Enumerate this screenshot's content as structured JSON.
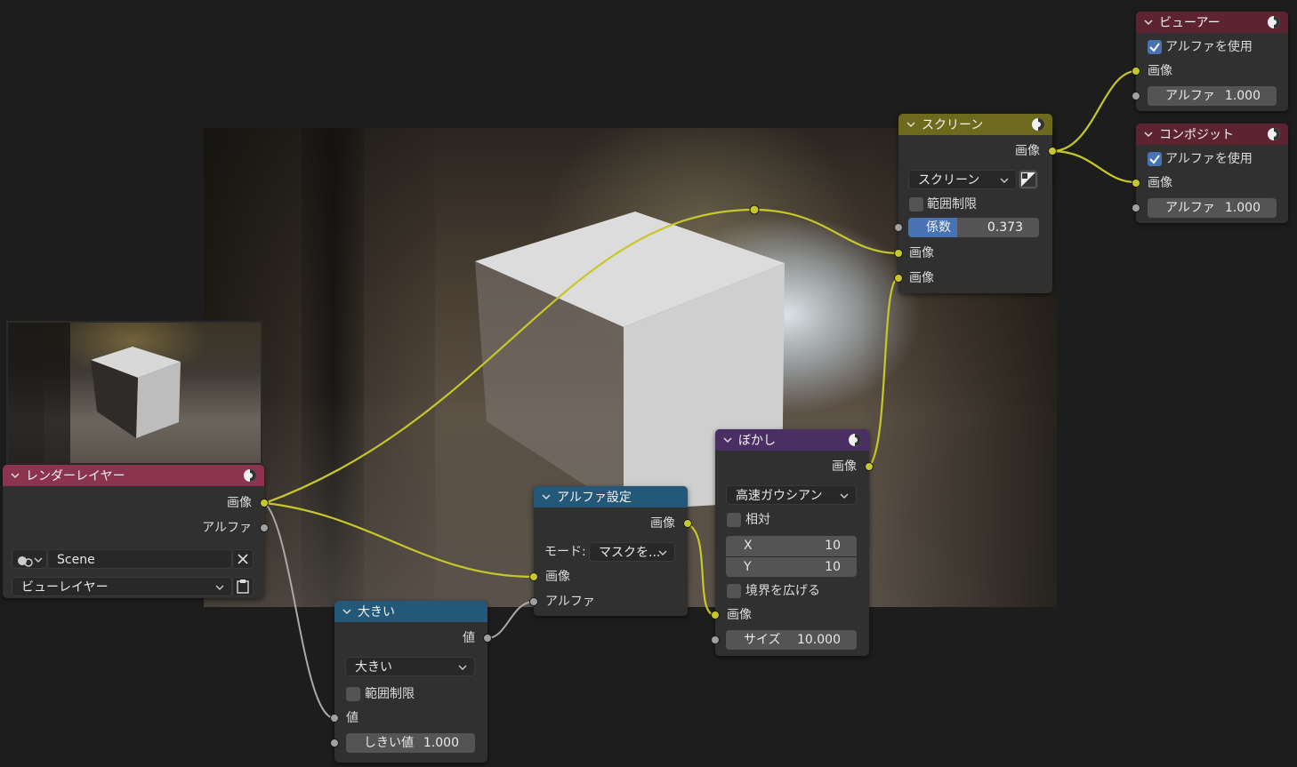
{
  "colors": {
    "link_color": "#c7c729",
    "value_link_color": "#a1a1a1",
    "accent": "#4772b3"
  },
  "render_layers": {
    "title": "レンダーレイヤー",
    "outputs": [
      "画像",
      "アルファ"
    ],
    "scene": "Scene",
    "view_layer": "ビューレイヤー"
  },
  "alpha_set": {
    "title": "アルファ設定",
    "output": "画像",
    "mode_label": "モード:",
    "mode_value": "マスクを...",
    "inputs": [
      "画像",
      "アルファ"
    ]
  },
  "greater": {
    "title": "大きい",
    "output": "値",
    "operation": "大きい",
    "clamp_label": "範囲制限",
    "input_value": "値",
    "threshold_label": "しきい値",
    "threshold_value": "1.000"
  },
  "blur": {
    "title": "ぼかし",
    "output": "画像",
    "filter": "高速ガウシアン",
    "relative_label": "相対",
    "x_label": "X",
    "x_value": "10",
    "y_label": "Y",
    "y_value": "10",
    "extend_label": "境界を広げる",
    "input_image": "画像",
    "size_label": "サイズ",
    "size_value": "10.000"
  },
  "screen": {
    "title": "スクリーン",
    "output": "画像",
    "blend_mode": "スクリーン",
    "clamp_label": "範囲制限",
    "factor_label": "係数",
    "factor_value": "0.373",
    "factor_fraction": 0.373,
    "inputs": [
      "画像",
      "画像"
    ]
  },
  "viewer": {
    "title": "ビューアー",
    "use_alpha_label": "アルファを使用",
    "use_alpha_checked": true,
    "input_image": "画像",
    "alpha_label": "アルファ",
    "alpha_value": "1.000"
  },
  "composite": {
    "title": "コンポジット",
    "use_alpha_label": "アルファを使用",
    "use_alpha_checked": true,
    "input_image": "画像",
    "alpha_label": "アルファ",
    "alpha_value": "1.000"
  }
}
